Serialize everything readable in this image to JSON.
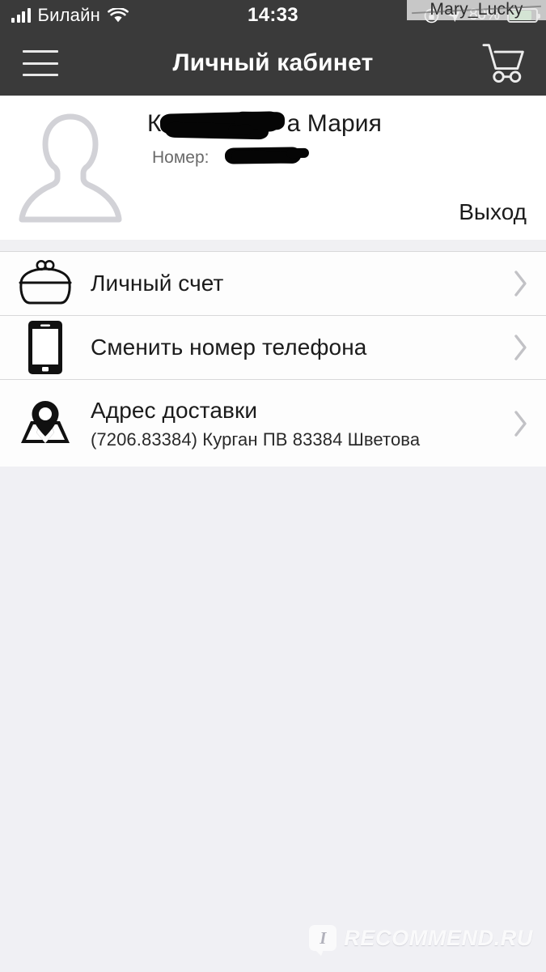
{
  "status_bar": {
    "carrier": "Билайн",
    "time": "14:33",
    "battery_percent": "80%",
    "icons": [
      "signal-bars-icon",
      "wifi-icon",
      "rotation-lock-icon",
      "location-arrow-icon",
      "battery-icon"
    ]
  },
  "watermark_top": {
    "text": "Mary_Lucky"
  },
  "header": {
    "title": "Личный кабинет",
    "menu_icon": "hamburger-menu-icon",
    "cart_icon": "shopping-cart-icon"
  },
  "profile": {
    "avatar_icon": "person-silhouette-icon",
    "name_visible_prefix": "К",
    "name_visible_suffix": "а Мария",
    "number_label": "Номер:",
    "number_value": "",
    "logout_label": "Выход",
    "redacted": true
  },
  "menu": {
    "items": [
      {
        "label": "Личный счет",
        "sub": "",
        "icon": "coin-purse-icon",
        "chevron": "chevron-right-icon"
      },
      {
        "label": "Сменить номер телефона",
        "sub": "",
        "icon": "smartphone-icon",
        "chevron": "chevron-right-icon"
      },
      {
        "label": "Адрес доставки",
        "sub": "(7206.83384) Курган ПВ 83384 Шветова",
        "icon": "map-pin-icon",
        "chevron": "chevron-right-icon"
      }
    ]
  },
  "watermark_footer": {
    "mark": "I",
    "text": "RECOMMEND.RU"
  },
  "colors": {
    "header_bg": "#3a3a3a",
    "card_bg": "#ffffff",
    "page_bg": "#f0f0f4",
    "divider": "#d8d8da",
    "text_primary": "#1b1b1b",
    "text_muted": "#6a6a6a",
    "chevron": "#c2c2c6",
    "battery_fill": "#79c67a"
  }
}
